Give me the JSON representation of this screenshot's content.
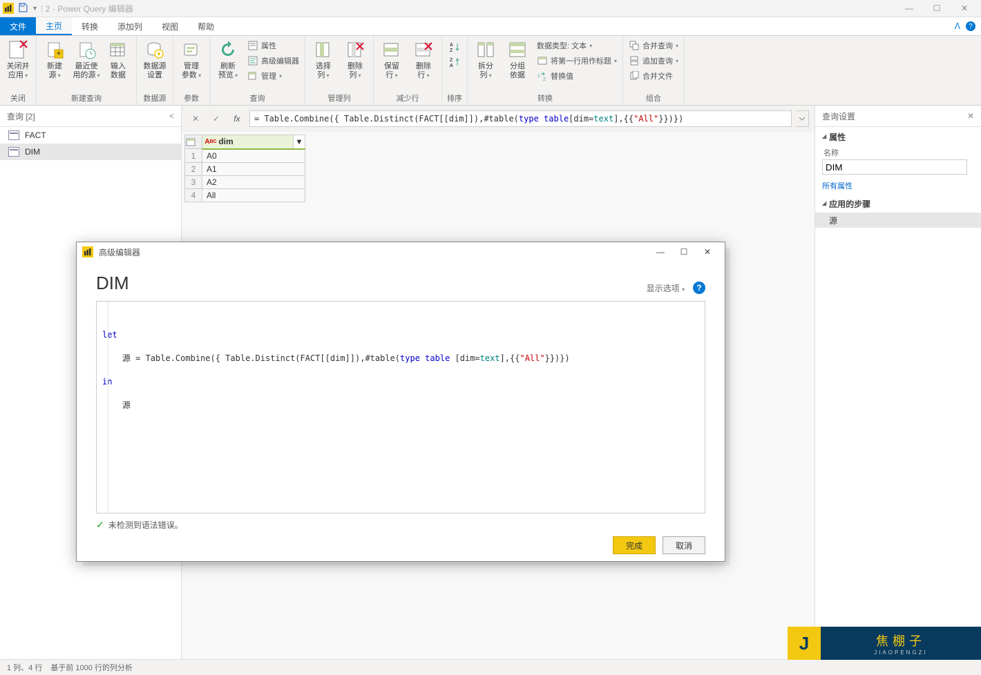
{
  "titlebar": {
    "title": "2 - Power Query 编辑器"
  },
  "tabs": {
    "file": "文件",
    "home": "主页",
    "transform": "转换",
    "addcol": "添加列",
    "view": "视图",
    "help": "帮助"
  },
  "ribbon": {
    "close": {
      "btn": "关闭并\n应用",
      "group": "关闭"
    },
    "newquery": {
      "newsrc": "新建\n源",
      "recent": "最近使\n用的源",
      "enter": "输入\n数据",
      "group": "新建查询"
    },
    "ds": {
      "settings": "数据源\n设置",
      "group": "数据源"
    },
    "param": {
      "manage": "管理\n参数",
      "group": "参数"
    },
    "query": {
      "refresh": "刷新\n预览",
      "props": "属性",
      "adv": "高级编辑器",
      "manage": "管理",
      "group": "查询"
    },
    "managecol": {
      "choose": "选择\n列",
      "remove": "删除\n列",
      "group": "管理列"
    },
    "reducerows": {
      "keep": "保留\n行",
      "remove": "删除\n行",
      "group": "减少行"
    },
    "sort": {
      "group": "排序"
    },
    "transform": {
      "split": "拆分\n列",
      "groupby": "分组\n依据",
      "datatype": "数据类型: 文本",
      "firstrow": "将第一行用作标题",
      "replace": "替换值",
      "group": "转换"
    },
    "combine": {
      "merge": "合并查询",
      "append": "追加查询",
      "combinefiles": "合并文件",
      "group": "组合"
    }
  },
  "queries": {
    "header": "查询 [2]",
    "items": [
      {
        "name": "FACT"
      },
      {
        "name": "DIM"
      }
    ]
  },
  "formula": {
    "prefix": "= Table.Combine({ Table.Distinct(FACT[[dim]]),#table(",
    "kw_type": "type",
    "kw_table": "table",
    "mid": " [dim=",
    "kw_text": "text",
    "mid2": "],{{",
    "str_all": "\"All\"",
    "suffix": "}})})"
  },
  "table": {
    "column": "dim",
    "rows": [
      "A0",
      "A1",
      "A2",
      "All"
    ]
  },
  "settings": {
    "header": "查询设置",
    "props_title": "属性",
    "name_label": "名称",
    "name_value": "DIM",
    "all_props": "所有属性",
    "steps_title": "应用的步骤",
    "step_source": "源"
  },
  "status": {
    "cols": "1 列、4 行",
    "profiling": "基于前 1000 行的列分析"
  },
  "dialog": {
    "title": "高级编辑器",
    "heading": "DIM",
    "display_opt": "显示选项",
    "code": {
      "let": "let",
      "line": "    源 = Table.Combine({ Table.Distinct(FACT[[dim]]),#table(",
      "kw_type": "type",
      "kw_table": "table",
      "mid": " [dim=",
      "kw_text": "text",
      "mid2": "],{{",
      "str": "\"All\"",
      "end": "}})})",
      "in": "in",
      "ret": "    源"
    },
    "syntax_ok": "未检测到语法错误。",
    "done": "完成",
    "cancel": "取消"
  },
  "watermark": {
    "main": "焦棚子",
    "sub": "JIAOPENGZI"
  }
}
